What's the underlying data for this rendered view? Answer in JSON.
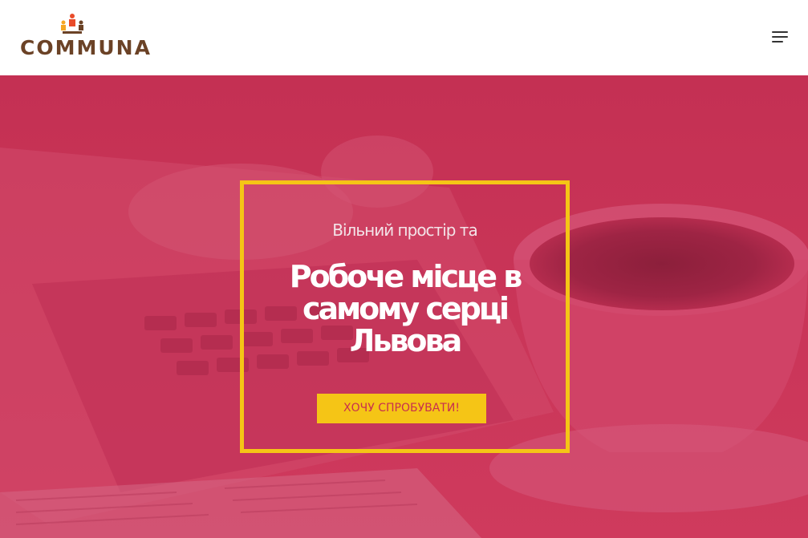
{
  "header": {
    "logo_text": "COMMUNA",
    "menu_icon": "hamburger-menu-icon"
  },
  "hero": {
    "subtitle": "Вільний простір та",
    "title": "Робоче місце в самому серці Львова",
    "cta_label": "ХОЧУ СПРОБУВАТИ!"
  },
  "colors": {
    "overlay": "#c83257",
    "accent_yellow": "#f5c516",
    "logo_brown": "#6b4226",
    "button_text": "#c8304e"
  }
}
